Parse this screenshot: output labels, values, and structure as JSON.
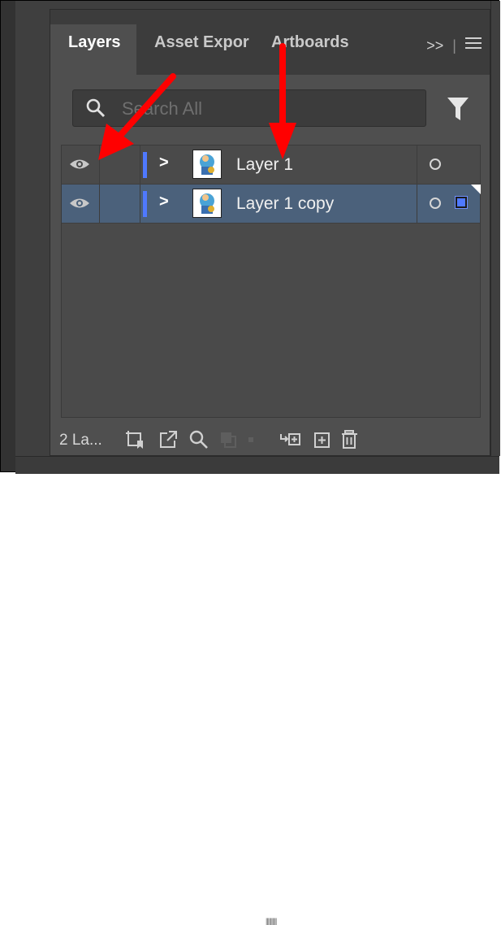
{
  "tabs": [
    {
      "label": "Layers",
      "active": true
    },
    {
      "label": "Asset Expor",
      "active": false
    },
    {
      "label": "Artboards",
      "active": false
    }
  ],
  "tab_overflow": ">>",
  "tab_menu_icon": "hamburger-menu-icon",
  "search": {
    "placeholder": "Search All",
    "value": ""
  },
  "layers": [
    {
      "name": "Layer 1",
      "visible": true,
      "selected": false,
      "color": "#4f79ff"
    },
    {
      "name": "Layer 1 copy",
      "visible": true,
      "selected": true,
      "color": "#4f79ff"
    }
  ],
  "footer": {
    "count_label": "2 La...",
    "icons": [
      "collect-export-icon",
      "export-icon",
      "locate-object-icon",
      "clipping-mask-icon",
      "new-sublayer-icon",
      "new-layer-icon",
      "trash-icon"
    ]
  },
  "annotation_color": "#ff0000"
}
